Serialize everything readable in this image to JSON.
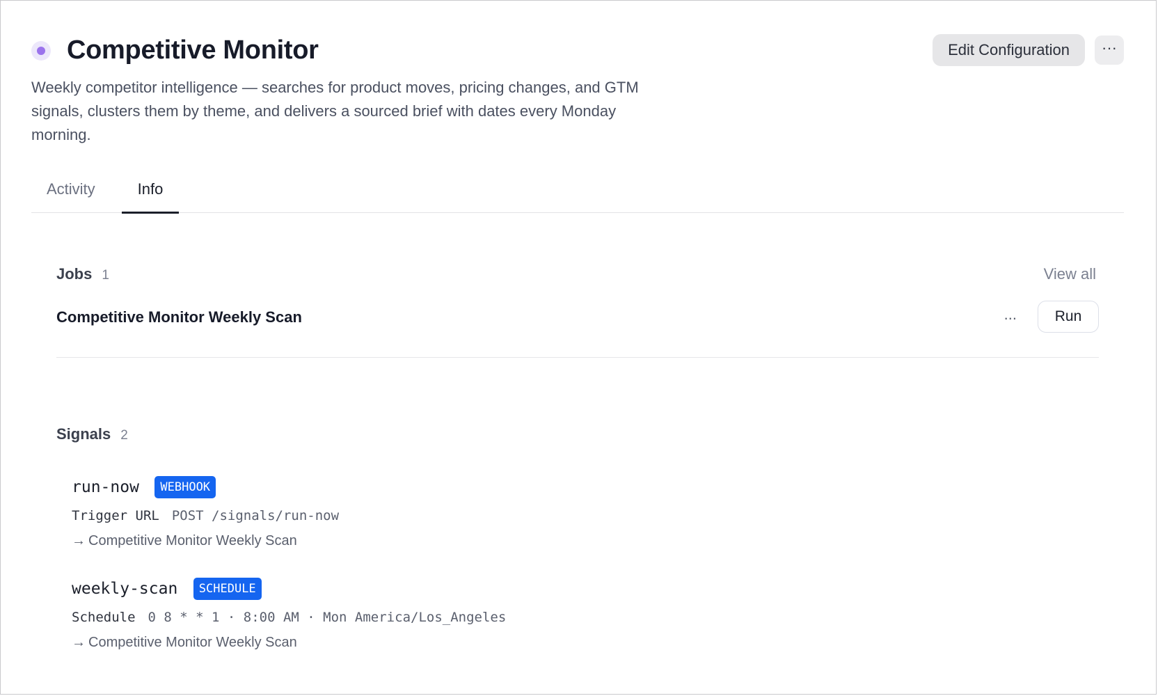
{
  "header": {
    "title": "Competitive Monitor",
    "status_color": "#9b73ec",
    "edit_label": "Edit Configuration",
    "more_label": "···"
  },
  "description": "Weekly competitor intelligence — searches for product moves, pricing changes, and GTM signals, clusters them by theme, and delivers a sourced brief with dates every Monday morning.",
  "tabs": [
    {
      "label": "Activity",
      "active": false
    },
    {
      "label": "Info",
      "active": true
    }
  ],
  "jobs": {
    "title": "Jobs",
    "count": "1",
    "view_all_label": "View all",
    "items": [
      {
        "name": "Competitive Monitor Weekly Scan",
        "ellipsis": "...",
        "run_label": "Run"
      }
    ]
  },
  "signals": {
    "title": "Signals",
    "count": "2",
    "items": [
      {
        "name": "run-now",
        "badge": "WEBHOOK",
        "detail_label": "Trigger URL",
        "detail_value": "POST /signals/run-now",
        "arrow": "→",
        "target": "Competitive Monitor Weekly Scan"
      },
      {
        "name": "weekly-scan",
        "badge": "SCHEDULE",
        "detail_label": "Schedule",
        "detail_value": "0 8 * * 1 · 8:00 AM · Mon America/Los_Angeles",
        "arrow": "→",
        "target": "Competitive Monitor Weekly Scan"
      }
    ]
  },
  "colors": {
    "badge": "#1565f0",
    "accent_dot": "#9b73ec"
  }
}
